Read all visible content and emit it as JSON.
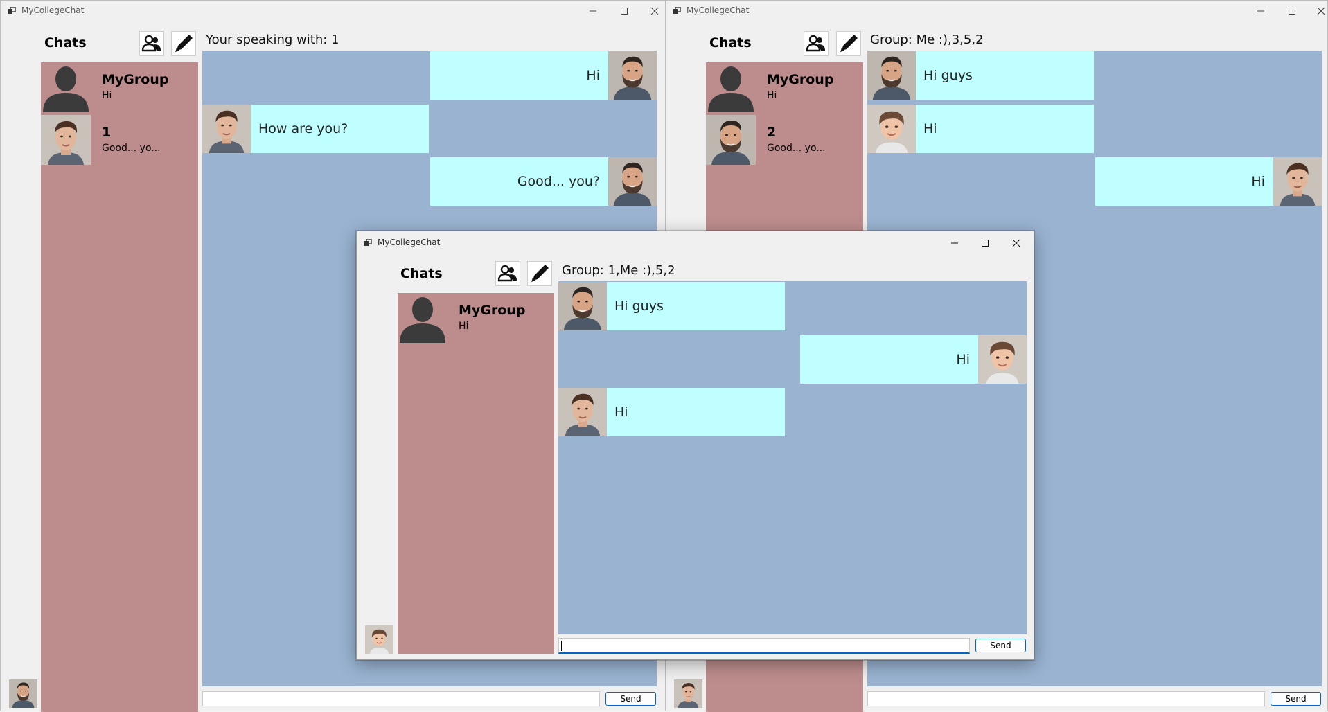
{
  "app_title": "MyCollegeChat",
  "colors": {
    "sidebar": "#bd8d8d",
    "messages": "#99b3d1",
    "bubble": "#c0ffff",
    "accent": "#0067c0"
  },
  "windows": {
    "left": {
      "chats_label": "Chats",
      "convo_title": "Your speaking with: 1",
      "chats": [
        {
          "name": "MyGroup",
          "preview": "Hi",
          "avatar": "silhouette"
        },
        {
          "name": "1",
          "preview": "Good... yo...",
          "avatar": "young-man"
        }
      ],
      "messages": [
        {
          "side": "right",
          "text": "Hi",
          "avatar": "bearded-man"
        },
        {
          "side": "left",
          "text": "How are you?",
          "avatar": "young-man"
        },
        {
          "side": "right",
          "text": "Good... you?",
          "avatar": "bearded-man"
        }
      ],
      "input_value": "",
      "send_label": "Send",
      "me_avatar": "bearded-man"
    },
    "right": {
      "chats_label": "Chats",
      "convo_title": "Group: Me :),3,5,2",
      "chats": [
        {
          "name": "MyGroup",
          "preview": "Hi",
          "avatar": "silhouette"
        },
        {
          "name": "2",
          "preview": "Good... yo...",
          "avatar": "bearded-man"
        }
      ],
      "messages": [
        {
          "side": "left",
          "text": "Hi guys",
          "avatar": "bearded-man"
        },
        {
          "side": "left",
          "text": "Hi",
          "avatar": "boy"
        },
        {
          "side": "right",
          "text": "Hi",
          "avatar": "young-man"
        }
      ],
      "input_value": "",
      "send_label": "Send",
      "me_avatar": "young-man"
    },
    "front": {
      "chats_label": "Chats",
      "convo_title": "Group: 1,Me :),5,2",
      "chats": [
        {
          "name": "MyGroup",
          "preview": "Hi",
          "avatar": "silhouette"
        }
      ],
      "messages": [
        {
          "side": "left",
          "text": "Hi guys",
          "avatar": "bearded-man"
        },
        {
          "side": "right",
          "text": "Hi",
          "avatar": "boy"
        },
        {
          "side": "left",
          "text": "Hi",
          "avatar": "young-man"
        }
      ],
      "input_value": "",
      "send_label": "Send",
      "me_avatar": "boy"
    }
  }
}
